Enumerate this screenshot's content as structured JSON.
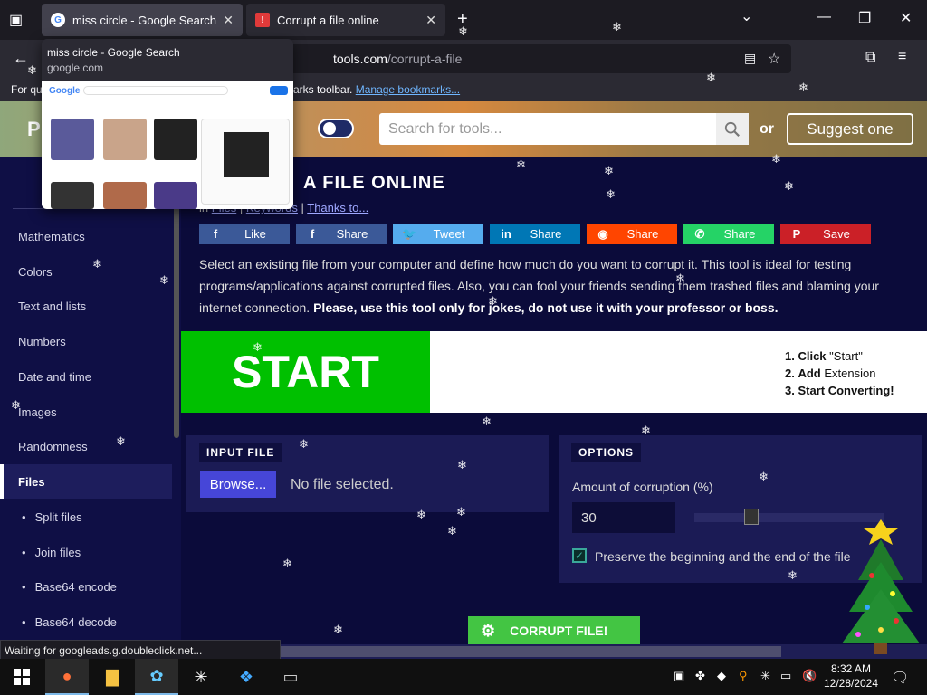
{
  "browser": {
    "tabs": [
      {
        "title": "miss circle - Google Search",
        "close": "✕"
      },
      {
        "title": "Corrupt a file online",
        "close": "✕"
      }
    ],
    "new_tab": "+",
    "tab_list": "⌄",
    "url_domain": "tools.com",
    "url_path": "/corrupt-a-file",
    "bookmarks_prefix": "For qu",
    "bookmarks_mid": "arks toolbar.",
    "bookmarks_link": "Manage bookmarks...",
    "preview": {
      "title": "miss circle - Google Search",
      "url": "google.com"
    },
    "status": "Waiting for googleads.g.doubleclick.net..."
  },
  "site": {
    "logo": "P",
    "search_placeholder": "Search for tools...",
    "or_text": "or",
    "suggest_label": "Suggest one"
  },
  "sidebar": {
    "items": [
      {
        "label": "Mathematics"
      },
      {
        "label": "Colors"
      },
      {
        "label": "Text and lists"
      },
      {
        "label": "Numbers"
      },
      {
        "label": "Date and time"
      },
      {
        "label": "Images"
      },
      {
        "label": "Randomness"
      },
      {
        "label": "Files"
      }
    ],
    "subitems": [
      {
        "label": "Split files"
      },
      {
        "label": "Join files"
      },
      {
        "label": "Base64 encode"
      },
      {
        "label": "Base64 decode"
      }
    ]
  },
  "main": {
    "title": "A FILE ONLINE",
    "crumbs": {
      "in": "in",
      "files": "Files",
      "keywords": "Keywords",
      "thanks": "Thanks to..."
    },
    "share": [
      {
        "icon": "f",
        "label": "Like",
        "color": "#3b5998"
      },
      {
        "icon": "f",
        "label": "Share",
        "color": "#3b5998"
      },
      {
        "icon": "🐦",
        "label": "Tweet",
        "color": "#55acee"
      },
      {
        "icon": "in",
        "label": "Share",
        "color": "#0077b5"
      },
      {
        "icon": "◉",
        "label": "Share",
        "color": "#ff4500"
      },
      {
        "icon": "✆",
        "label": "Share",
        "color": "#25d366"
      },
      {
        "icon": "P",
        "label": "Save",
        "color": "#cb2027"
      }
    ],
    "description": "Select an existing file from your computer and define how much do you want to corrupt it. This tool is ideal for testing programs/applications against corrupted files. Also, you can fool your friends sending them trashed files and blaming your internet connection.",
    "description_bold": "Please, use this tool only for jokes, do not use it with your professor or boss."
  },
  "ad": {
    "start": "START",
    "steps": [
      {
        "num": "1.",
        "bold": "Click",
        "rest": "\"Start\""
      },
      {
        "num": "2.",
        "bold": "Add",
        "rest": "Extension"
      },
      {
        "num": "3.",
        "bold": "Start Converting!",
        "rest": ""
      }
    ]
  },
  "input_panel": {
    "tag": "INPUT FILE",
    "browse": "Browse...",
    "no_file": "No file selected."
  },
  "options_panel": {
    "tag": "OPTIONS",
    "amount_label": "Amount of corruption (%)",
    "amount_value": "30",
    "preserve_label": "Preserve the beginning and the end of the file",
    "preserve_checked": true
  },
  "action": {
    "corrupt_label": "CORRUPT FILE!"
  },
  "taskbar": {
    "time": "8:32 AM",
    "date": "12/28/2024"
  }
}
